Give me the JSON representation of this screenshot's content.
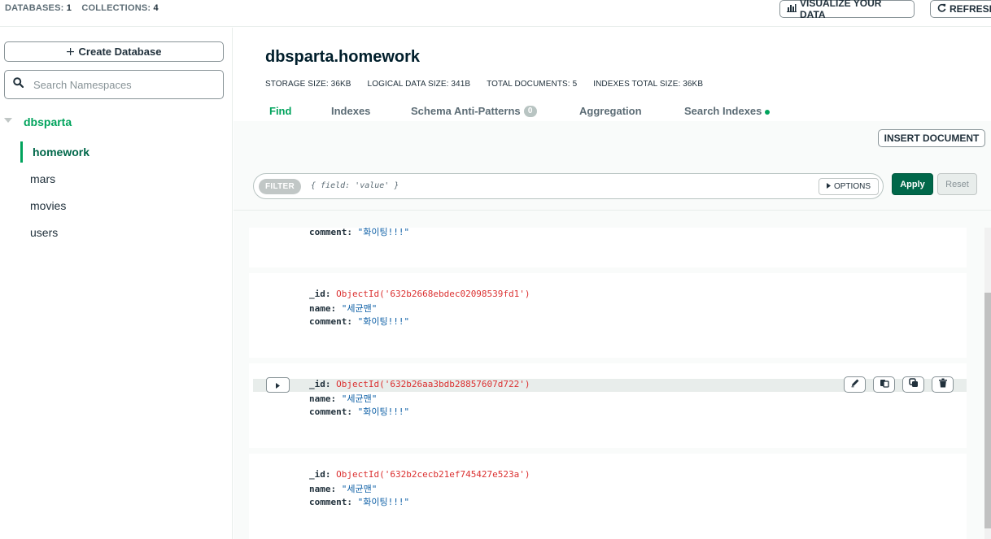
{
  "topbar": {
    "databases_label": "DATABASES:",
    "databases_count": "1",
    "collections_label": "COLLECTIONS:",
    "collections_count": "4",
    "visualize_label": "VISUALIZE YOUR DATA",
    "refresh_label": "REFRESH"
  },
  "sidebar": {
    "create_label": "Create Database",
    "search_placeholder": "Search Namespaces",
    "database": "dbsparta",
    "collections": [
      "homework",
      "mars",
      "movies",
      "users"
    ],
    "active_collection": "homework"
  },
  "header": {
    "title": "dbsparta.homework",
    "storage_size": "STORAGE SIZE: 36KB",
    "logical_size": "LOGICAL DATA SIZE: 341B",
    "total_documents": "TOTAL DOCUMENTS: 5",
    "indexes_size": "INDEXES TOTAL SIZE: 36KB"
  },
  "tabs": {
    "find": "Find",
    "indexes": "Indexes",
    "schema": "Schema Anti-Patterns",
    "schema_badge": "0",
    "aggregation": "Aggregation",
    "search_indexes": "Search Indexes",
    "active": "Find"
  },
  "toolbar": {
    "insert_label": "INSERT DOCUMENT",
    "filter_label": "FILTER",
    "filter_placeholder": "{ field: 'value' }",
    "options_label": "OPTIONS",
    "apply_label": "Apply",
    "reset_label": "Reset"
  },
  "documents": [
    {
      "comment_key": "comment:",
      "comment": "\"화이팅!!!\""
    },
    {
      "id_key": "_id:",
      "id": "ObjectId('632b2668ebdec02098539fd1')",
      "name_key": "name:",
      "name": "\"세균맨\"",
      "comment_key": "comment:",
      "comment": "\"화이팅!!!\""
    },
    {
      "id_key": "_id:",
      "id": "ObjectId('632b26aa3bdb28857607d722')",
      "name_key": "name:",
      "name": "\"세균맨\"",
      "comment_key": "comment:",
      "comment": "\"화이팅!!!\""
    },
    {
      "id_key": "_id:",
      "id": "ObjectId('632b2cecb21ef745427e523a')",
      "name_key": "name:",
      "name": "\"세균맨\"",
      "comment_key": "comment:",
      "comment": "\"화이팅!!!\""
    }
  ],
  "icons": {
    "visualize": "bar-chart-icon",
    "refresh": "refresh-icon",
    "create": "plus-icon",
    "search": "search-icon",
    "options": "caret-right-icon",
    "edit": "pencil-icon",
    "copy": "copy-icon",
    "clone": "clone-icon",
    "delete": "trash-icon"
  },
  "colors": {
    "accent_green": "#00a35c",
    "apply_green": "#00684a",
    "objectid_red": "#db3030",
    "string_blue": "#0d5fa6"
  }
}
